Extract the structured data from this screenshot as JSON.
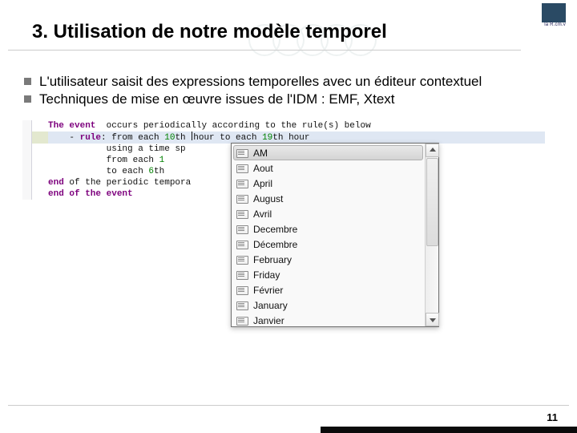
{
  "logo": {
    "label": "la R.cm.v"
  },
  "title": "3. Utilisation de notre modèle temporel",
  "bullets": [
    "L'utilisateur saisit des expressions temporelles avec un éditeur contextuel",
    "Techniques de mise en œuvre issues de l'IDM : EMF, Xtext"
  ],
  "code": {
    "l1_kw1": "The event",
    "l1_t": "  occurs periodically according to the rule(s) below",
    "l2_t1": "    - ",
    "l2_kw": "rule",
    "l2_t2": ": from each ",
    "l2_n1": "10",
    "l2_t3": "th ",
    "l2_t4": "hour to each ",
    "l2_n2": "19",
    "l2_t5": "th hour",
    "l3_t": "           using a time sp",
    "l4_t1": "           from each ",
    "l4_n": "1",
    "l5_t1": "           to each ",
    "l5_n": "6",
    "l5_t2": "th",
    "l6_kw": "end",
    "l6_t": " of the periodic tempora",
    "l7_kw": "end of the event"
  },
  "popup": {
    "items": [
      "AM",
      "Aout",
      "April",
      "August",
      "Avril",
      "Decembre",
      "Décembre",
      "February",
      "Friday",
      "Février",
      "January",
      "Janvier"
    ],
    "selected_index": 0
  },
  "page_number": "11"
}
